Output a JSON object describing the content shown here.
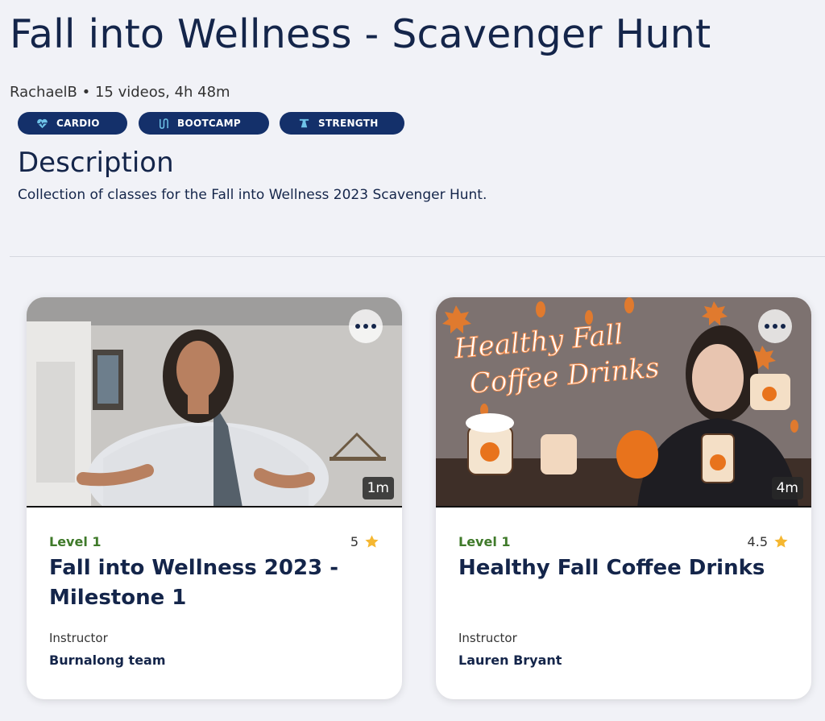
{
  "header": {
    "title": "Fall into Wellness - Scavenger Hunt",
    "meta": "RachaelB • 15 videos, 4h 48m"
  },
  "tags": [
    {
      "label": "CARDIO",
      "icon": "heart-pulse-icon"
    },
    {
      "label": "BOOTCAMP",
      "icon": "rope-icon"
    },
    {
      "label": "STRENGTH",
      "icon": "kettlebell-icon"
    }
  ],
  "description": {
    "heading": "Description",
    "text": "Collection of classes for the Fall into Wellness 2023 Scavenger Hunt."
  },
  "colors": {
    "background": "#f1f2f7",
    "navy": "#14254a",
    "tag_bg": "#14306a",
    "level_green": "#3f7a2a",
    "star": "#f5b731"
  },
  "cards": [
    {
      "duration": "1m",
      "level": "Level 1",
      "rating": "5",
      "title": "Fall into Wellness 2023 - Milestone 1",
      "instructor_label": "Instructor",
      "instructor": "Burnalong team"
    },
    {
      "duration": "4m",
      "level": "Level 1",
      "rating": "4.5",
      "title": "Healthy Fall Coffee Drinks",
      "instructor_label": "Instructor",
      "instructor": "Lauren Bryant",
      "thumbnail_text": "Healthy Fall Coffee Drinks"
    }
  ]
}
